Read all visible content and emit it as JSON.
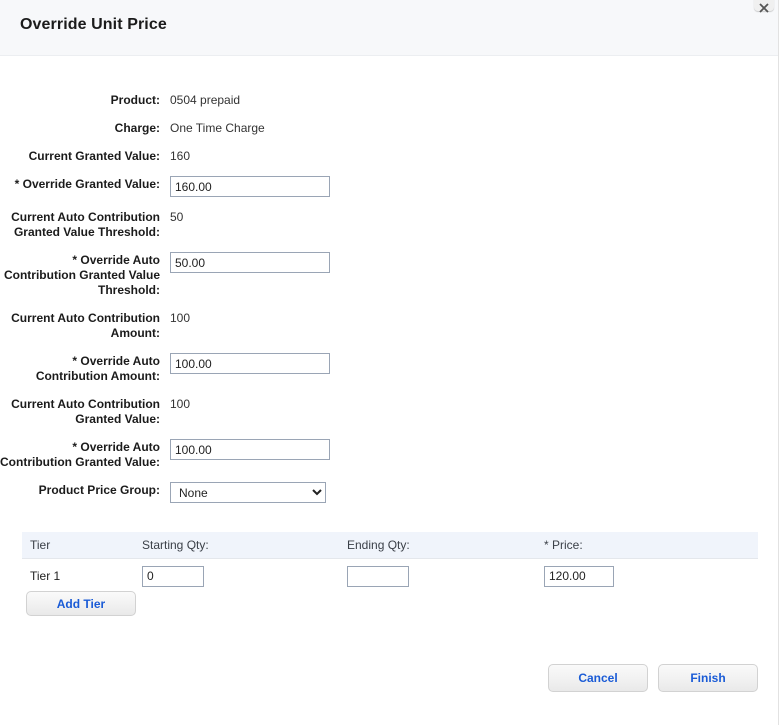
{
  "dialog": {
    "title": "Override Unit Price",
    "close_icon": "close-icon"
  },
  "form": {
    "rows": [
      {
        "label": "Product:",
        "value": "0504 prepaid",
        "type": "text"
      },
      {
        "label": "Charge:",
        "value": "One Time Charge",
        "type": "text"
      },
      {
        "label": "Current Granted Value:",
        "value": "160",
        "type": "text"
      },
      {
        "label": "* Override Granted Value:",
        "value": "160.00",
        "type": "input"
      },
      {
        "label": "Current Auto Contribution Granted Value Threshold:",
        "value": "50",
        "type": "text"
      },
      {
        "label": "* Override Auto Contribution Granted Value Threshold:",
        "value": "50.00",
        "type": "input"
      },
      {
        "label": "Current Auto Contribution Amount:",
        "value": "100",
        "type": "text"
      },
      {
        "label": "* Override Auto Contribution Amount:",
        "value": "100.00",
        "type": "input"
      },
      {
        "label": "Current Auto Contribution Granted Value:",
        "value": "100",
        "type": "text"
      },
      {
        "label": "* Override Auto Contribution Granted Value:",
        "value": "100.00",
        "type": "input"
      },
      {
        "label": "Product Price Group:",
        "value": "None",
        "type": "select"
      }
    ],
    "price_group_options": [
      "None"
    ]
  },
  "tier_table": {
    "headers": {
      "tier": "Tier",
      "starting_qty": "Starting Qty:",
      "ending_qty": "Ending Qty:",
      "price": "* Price:"
    },
    "rows": [
      {
        "tier": "Tier 1",
        "starting_qty": "0",
        "ending_qty": "",
        "price": "120.00"
      }
    ],
    "add_tier_label": "Add Tier"
  },
  "footer": {
    "cancel_label": "Cancel",
    "finish_label": "Finish"
  },
  "colors": {
    "header_bg": "#f7f8fa",
    "table_header_bg": "#f0f4fb",
    "link_blue": "#1a5bd6",
    "input_border": "#9aa5b5"
  }
}
